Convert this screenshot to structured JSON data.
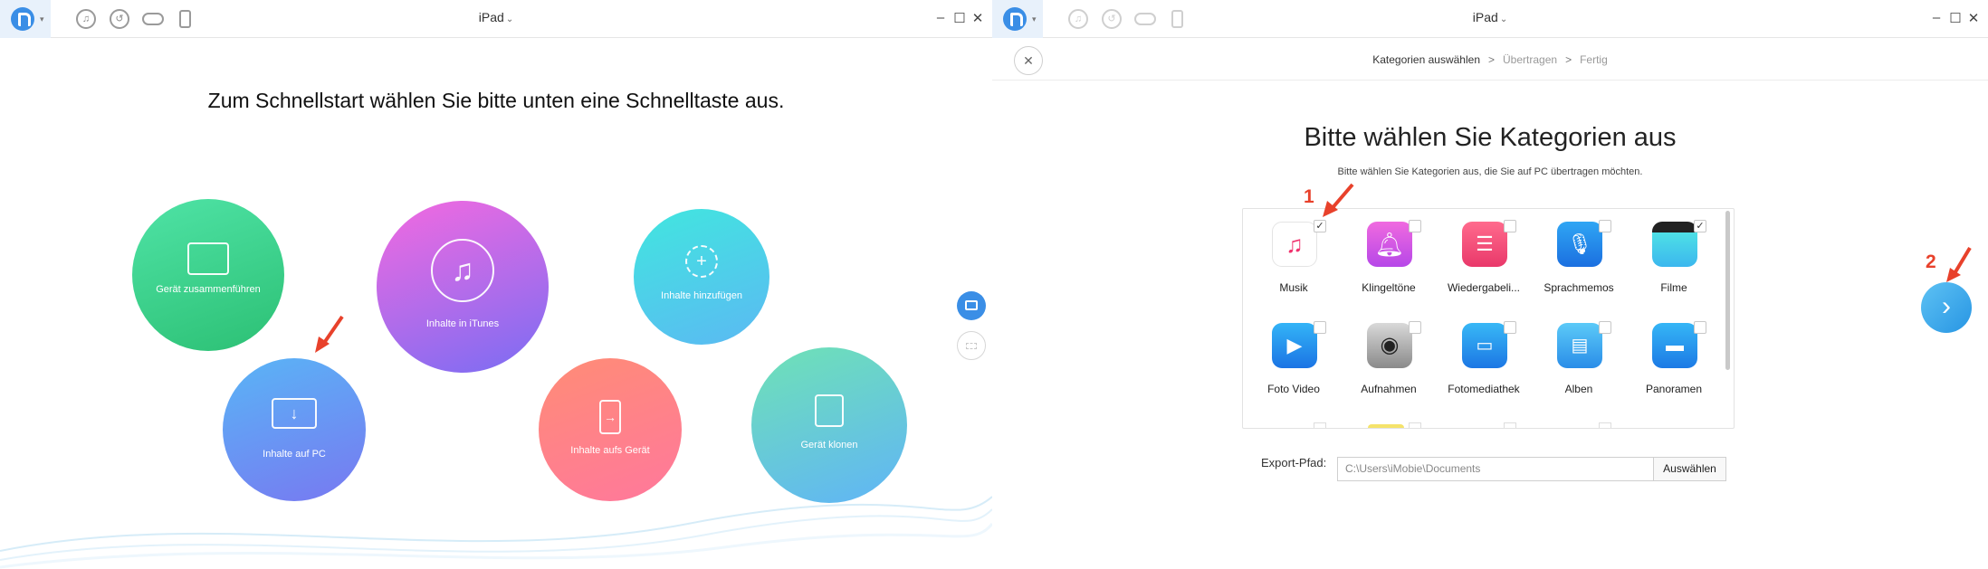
{
  "left_window": {
    "titlebar": {
      "device_name": "iPad",
      "icons": [
        "music-icon",
        "history-icon",
        "cloud-icon",
        "phone-icon"
      ]
    },
    "headline": "Zum Schnellstart wählen Sie bitte unten eine Schnelltaste aus.",
    "quick_buttons": [
      {
        "id": "merge",
        "label": "Gerät zusammenführen",
        "icon": "merge-icon",
        "color_from": "#48e0a0",
        "color_to": "#29c070"
      },
      {
        "id": "itunes",
        "label": "Inhalte in iTunes",
        "icon": "itunes-transfer-icon",
        "color_from": "#f06ae0",
        "color_to": "#7b6cf2"
      },
      {
        "id": "add",
        "label": "Inhalte hinzufügen",
        "icon": "add-content-icon",
        "color_from": "#40e8e0",
        "color_to": "#5bbaf2"
      },
      {
        "id": "to-pc",
        "label": "Inhalte auf PC",
        "icon": "monitor-download-icon",
        "color_from": "#5ab2f6",
        "color_to": "#7a78f0"
      },
      {
        "id": "to-device",
        "label": "Inhalte aufs Gerät",
        "icon": "phone-transfer-icon",
        "color_from": "#ff8a78",
        "color_to": "#ff7a9a"
      },
      {
        "id": "clone",
        "label": "Gerät klonen",
        "icon": "clone-device-icon",
        "color_from": "#6ee0b8",
        "color_to": "#62b6f6"
      }
    ],
    "side_icons": [
      "toolbox-icon",
      "grid-icon"
    ]
  },
  "right_window": {
    "titlebar": {
      "device_name": "iPad"
    },
    "steps": [
      "Kategorien auswählen",
      "Übertragen",
      "Fertig"
    ],
    "step_separator": ">",
    "title": "Bitte wählen Sie Kategorien aus",
    "subtitle": "Bitte wählen Sie Kategorien aus, die Sie auf PC übertragen möchten.",
    "categories": [
      {
        "label": "Musik",
        "icon": "music-note-icon",
        "checked": true
      },
      {
        "label": "Klingeltöne",
        "icon": "bell-icon",
        "checked": false
      },
      {
        "label": "Wiedergabeli...",
        "icon": "playlist-icon",
        "checked": false
      },
      {
        "label": "Sprachmemos",
        "icon": "microphone-icon",
        "checked": false
      },
      {
        "label": "Filme",
        "icon": "clapperboard-icon",
        "checked": true
      },
      {
        "label": "Foto Video",
        "icon": "video-camera-icon",
        "checked": false
      },
      {
        "label": "Aufnahmen",
        "icon": "camera-icon",
        "checked": false
      },
      {
        "label": "Fotomediathek",
        "icon": "photo-folder-icon",
        "checked": false
      },
      {
        "label": "Alben",
        "icon": "album-icon",
        "checked": false
      },
      {
        "label": "Panoramen",
        "icon": "panorama-icon",
        "checked": false
      }
    ],
    "checkmark": "✓",
    "export_label": "Export-Pfad:",
    "export_path": "C:\\Users\\iMobie\\Documents",
    "choose_button": "Auswählen",
    "next_glyph": "›"
  },
  "annotations": {
    "marker_1": "1",
    "marker_2": "2"
  },
  "colors": {
    "accent_blue": "#3a8ee6",
    "annotation_red": "#e8412b"
  }
}
